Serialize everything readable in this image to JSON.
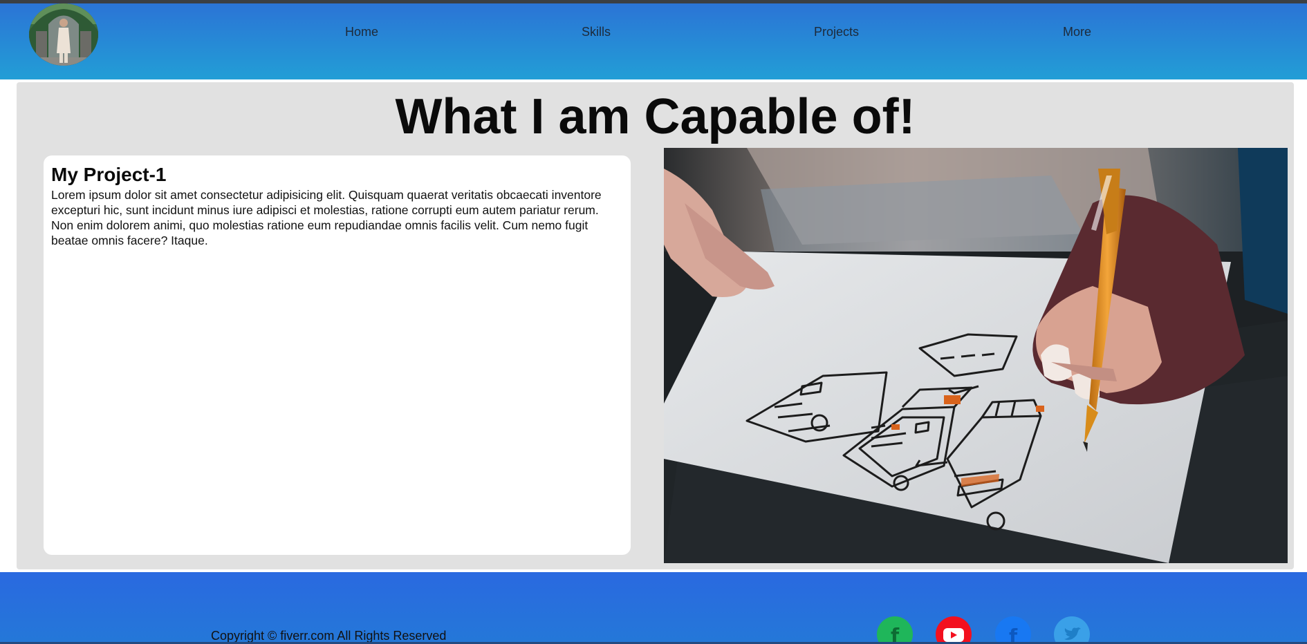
{
  "nav": {
    "items": [
      {
        "label": "Home"
      },
      {
        "label": "Skills"
      },
      {
        "label": "Projects"
      },
      {
        "label": "More"
      }
    ],
    "avatar_icon": "profile-photo"
  },
  "main": {
    "title": "What I am Capable of!",
    "card": {
      "title": "My Project-1",
      "body": "Lorem ipsum dolor sit amet consectetur adipisicing elit. Quisquam quaerat veritatis obcaecati inventore excepturi hic, sunt incidunt minus iure adipisci et molestias, ratione corrupti eum autem pariatur rerum. Non enim dolorem animi, quo molestias ratione eum repudiandae omnis facilis velit. Cum nemo fugit beatae omnis facere? Itaque."
    },
    "image_subject": "hand-sketching-wireframes"
  },
  "footer": {
    "copyright": "Copyright © fiverr.com All Rights Reserved",
    "social": [
      {
        "icon": "fiverr-icon",
        "color": "#1fb65a"
      },
      {
        "icon": "youtube-icon",
        "color": "#f3101e"
      },
      {
        "icon": "facebook-icon",
        "color": "#1878f2"
      },
      {
        "icon": "twitter-icon",
        "color": "#3aa0e8"
      }
    ]
  },
  "colors": {
    "header": "#2b74d6",
    "section_bg": "#e1e1e1",
    "footer": "#2a69e0"
  }
}
